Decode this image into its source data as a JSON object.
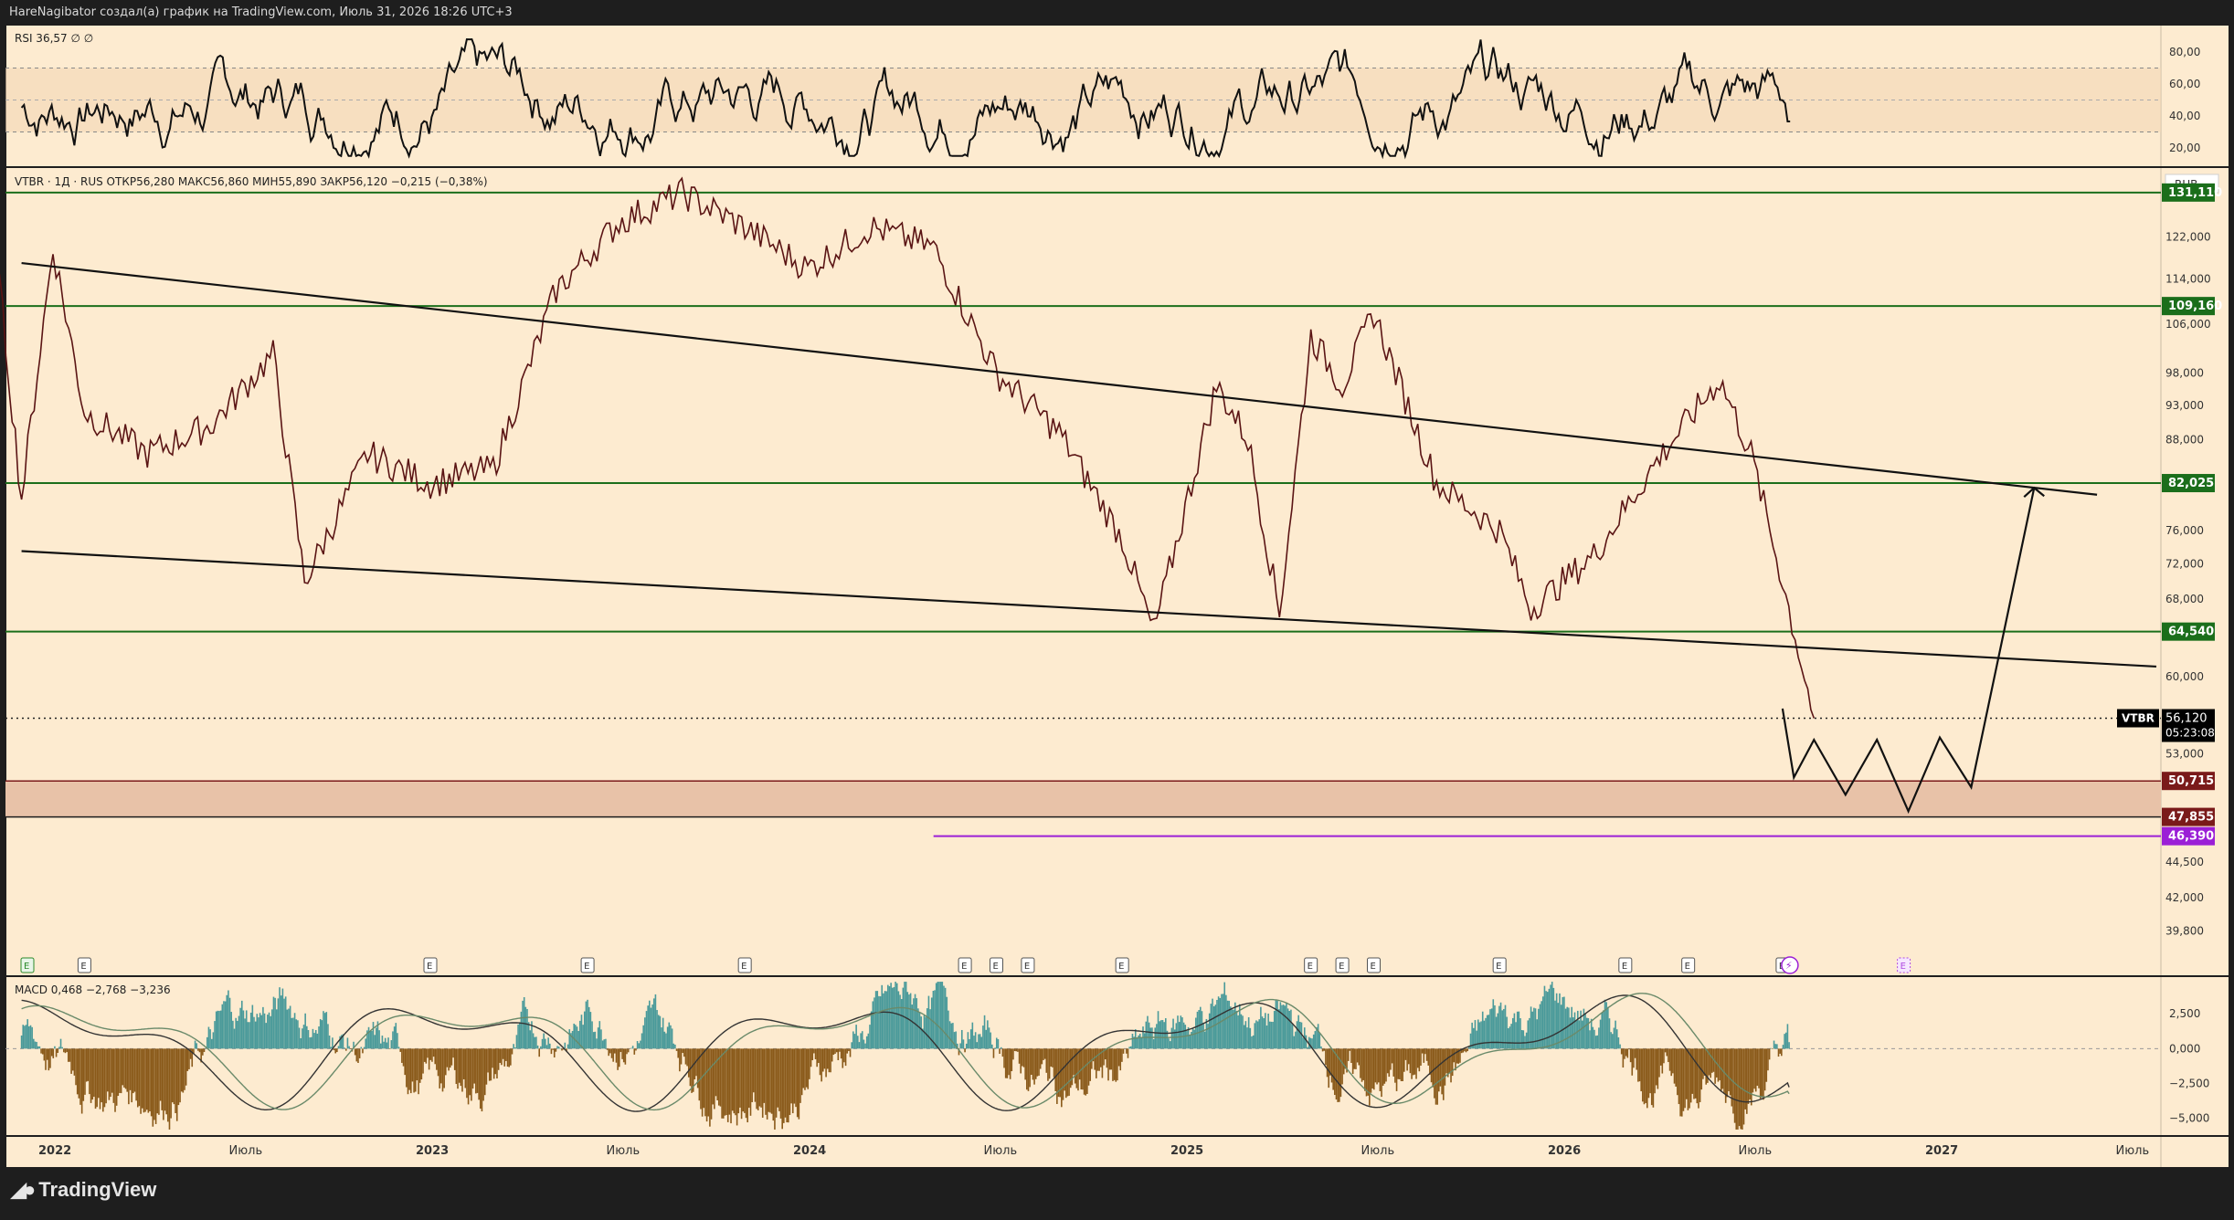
{
  "header": {
    "caption": "HareNagibator создал(а) график на TradingView.com, Июль 31, 2026 18:26 UTC+3"
  },
  "footer": {
    "brand": "TradingView"
  },
  "colors": {
    "background": "#fdebd0",
    "frame": "#1e1e1e",
    "level_line": "#1b6e1b",
    "level_badge": "#1b6e1b",
    "support_badge": "#7a1a1a",
    "target_badge": "#9b1fd6",
    "price_badge": "#000000",
    "macd_hist_pos": "#4a9a9a",
    "macd_hist_neg": "#8a5a1a",
    "zone_fill": "#e8c2a8"
  },
  "rsi": {
    "label": "RSI 36,57 ∅ ∅",
    "y_range": [
      12,
      92
    ],
    "ticks": [
      "80,00",
      "60,00",
      "40,00",
      "20,00"
    ],
    "tick_values": [
      80,
      60,
      40,
      20
    ],
    "bands": [
      70,
      50,
      30
    ],
    "end_value": 36.57
  },
  "main": {
    "symbol": "VTBR",
    "legend": "VTBR · 1Д · RUS  ОТКР56,280  МАКС56,860  МИН55,890  ЗАКР56,120  −0,215 (−0,38%)",
    "currency": "RUB",
    "scale": "log",
    "y_range": [
      37.5,
      136
    ],
    "ticks": [
      "122,000",
      "114,000",
      "106,000",
      "98,000",
      "93,000",
      "88,000",
      "76,000",
      "72,000",
      "68,000",
      "60,000",
      "53,000",
      "44,500",
      "42,000",
      "39,800"
    ],
    "tick_values": [
      122,
      114,
      106,
      98,
      93,
      88,
      76,
      72,
      68,
      60,
      53,
      44.5,
      42,
      39.8
    ],
    "levels": [
      {
        "value": 131.11,
        "label": "131,110",
        "kind": "resistance"
      },
      {
        "value": 109.16,
        "label": "109,160",
        "kind": "resistance"
      },
      {
        "value": 82.025,
        "label": "82,025",
        "kind": "resistance"
      },
      {
        "value": 64.54,
        "label": "64,540",
        "kind": "resistance"
      }
    ],
    "support_zone": {
      "top": 50.715,
      "bottom": 47.855,
      "top_label": "50,715",
      "bottom_label": "47,855"
    },
    "target_line": {
      "value": 46.39,
      "label": "46,390",
      "from": "2024-05"
    },
    "last_price": {
      "value": 56.12,
      "label": "56,120",
      "countdown": "05:23:08"
    },
    "trendlines": [
      {
        "from": [
          "2021-12",
          117
        ],
        "to": [
          "2027-06",
          80.5
        ]
      },
      {
        "from": [
          "2021-12",
          73.5
        ],
        "to": [
          "2027-12",
          61
        ]
      }
    ],
    "projection": [
      [
        "2026-08",
        57.0
      ],
      [
        "2026-08",
        51.0
      ],
      [
        "2026-09",
        54.2
      ],
      [
        "2026-10",
        49.6
      ],
      [
        "2026-11",
        54.2
      ],
      [
        "2026-12",
        48.3
      ],
      [
        "2027-01",
        54.4
      ],
      [
        "2027-02",
        50.2
      ],
      [
        "2027-04",
        81.4
      ]
    ],
    "earnings_markers": [
      "E",
      "E",
      "E",
      "E",
      "E",
      "E",
      "E",
      "E",
      "E",
      "E",
      "E",
      "E",
      "E",
      "E",
      "E",
      "E"
    ],
    "dividend_marker": "⚡",
    "future_earnings_marker": "E"
  },
  "macd": {
    "label": "MACD 0,468 −2,768 −3,236",
    "values": {
      "hist": 0.468,
      "macd": -2.768,
      "signal": -3.236
    },
    "y_range": [
      -6,
      5
    ],
    "ticks": [
      "2,500",
      "0,000",
      "−2,500",
      "−5,000"
    ],
    "tick_values": [
      2.5,
      0,
      -2.5,
      -5
    ]
  },
  "time_axis": {
    "ticks": [
      {
        "label": "2022",
        "date": "2022-01"
      },
      {
        "label": "Июль",
        "date": "2022-07"
      },
      {
        "label": "2023",
        "date": "2023-01"
      },
      {
        "label": "Июль",
        "date": "2023-07"
      },
      {
        "label": "2024",
        "date": "2024-01"
      },
      {
        "label": "Июль",
        "date": "2024-07"
      },
      {
        "label": "2025",
        "date": "2025-01"
      },
      {
        "label": "Июль",
        "date": "2025-07"
      },
      {
        "label": "2026",
        "date": "2026-01"
      },
      {
        "label": "Июль",
        "date": "2026-07"
      },
      {
        "label": "2027",
        "date": "2027-01"
      },
      {
        "label": "Июль",
        "date": "2027-07"
      }
    ]
  },
  "chart_data": {
    "type": "line",
    "title": "VTBR · 1Д · RUS",
    "price_path": [
      [
        "2021-11",
        131
      ],
      [
        "2021-12",
        80
      ],
      [
        "2022-01",
        120
      ],
      [
        "2022-02",
        92
      ],
      [
        "2022-04",
        86
      ],
      [
        "2022-06",
        90
      ],
      [
        "2022-08",
        101
      ],
      [
        "2022-09",
        70
      ],
      [
        "2022-11",
        86
      ],
      [
        "2023-01",
        82
      ],
      [
        "2023-03",
        84
      ],
      [
        "2023-05",
        112
      ],
      [
        "2023-07",
        125
      ],
      [
        "2023-09",
        131
      ],
      [
        "2023-11",
        124
      ],
      [
        "2024-01",
        116
      ],
      [
        "2024-03",
        124
      ],
      [
        "2024-05",
        120
      ],
      [
        "2024-07",
        98
      ],
      [
        "2024-09",
        89
      ],
      [
        "2024-11",
        75
      ],
      [
        "2024-12",
        64.5
      ],
      [
        "2025-02",
        96
      ],
      [
        "2025-03",
        88
      ],
      [
        "2025-04",
        66.5
      ],
      [
        "2025-05",
        104
      ],
      [
        "2025-06",
        96
      ],
      [
        "2025-07",
        108
      ],
      [
        "2025-08",
        94
      ],
      [
        "2025-09",
        82
      ],
      [
        "2025-11",
        76
      ],
      [
        "2025-12",
        67
      ],
      [
        "2026-02",
        73
      ],
      [
        "2026-04",
        85
      ],
      [
        "2026-06",
        97
      ],
      [
        "2026-07",
        86
      ],
      [
        "2026-08",
        70
      ],
      [
        "2026-09",
        56.12
      ]
    ],
    "ylabel": "RUB",
    "yscale": "log",
    "grid": false,
    "series_note": "daily candles (approximate path)"
  }
}
